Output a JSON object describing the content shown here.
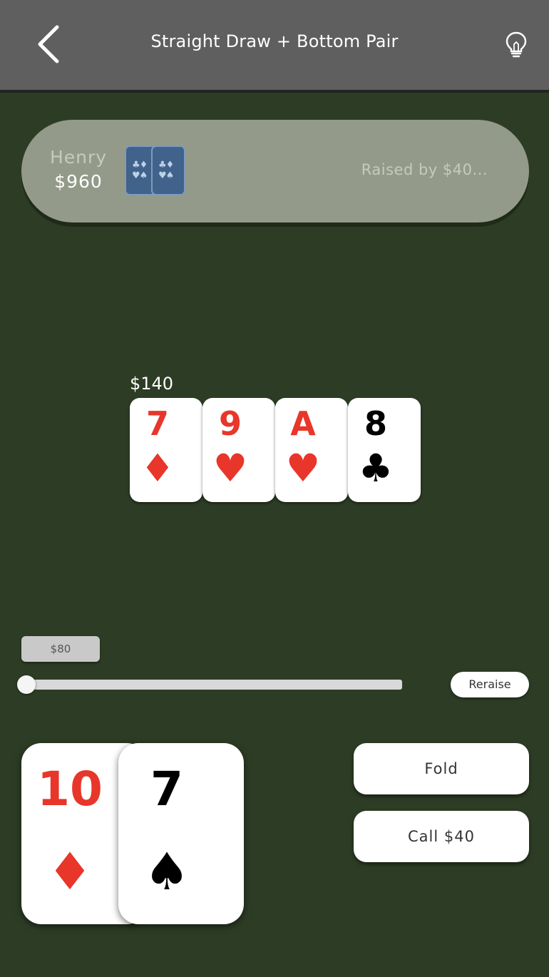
{
  "header": {
    "title": "Straight Draw + Bottom Pair",
    "back_icon": "chevron-left-icon",
    "hint_icon": "lightbulb-icon"
  },
  "opponent": {
    "name": "Henry",
    "stack": "$960",
    "status": "Raised by $40...",
    "cards": [
      {
        "pips": "♣♦ ♥♠",
        "icon": "card-back-icon"
      },
      {
        "pips": "♣♦ ♥♠",
        "icon": "card-back-icon"
      }
    ]
  },
  "table": {
    "pot": "$140",
    "board": [
      {
        "rank": "7",
        "suit": "♦",
        "suit_name": "diamond",
        "color": "#e8362a"
      },
      {
        "rank": "9",
        "suit": "♥",
        "suit_name": "heart",
        "color": "#e8362a"
      },
      {
        "rank": "A",
        "suit": "♥",
        "suit_name": "heart",
        "color": "#e8362a"
      },
      {
        "rank": "8",
        "suit": "♣",
        "suit_name": "club",
        "color": "#000000"
      }
    ]
  },
  "bet": {
    "amount_label": "$80",
    "slider_fraction": 0.0,
    "reraise_label": "Reraise"
  },
  "hand": [
    {
      "rank": "10",
      "suit": "♦",
      "suit_name": "diamond",
      "color": "#e8362a"
    },
    {
      "rank": "7",
      "suit": "♠",
      "suit_name": "spade",
      "color": "#000000"
    }
  ],
  "actions": {
    "fold_label": "Fold",
    "call_label": "Call $40"
  },
  "colors": {
    "felt": "#2d3d25",
    "header": "#5f5f5f",
    "opponent_panel": "#949a89",
    "red_suit": "#e8362a",
    "card_back": "#41628a"
  }
}
